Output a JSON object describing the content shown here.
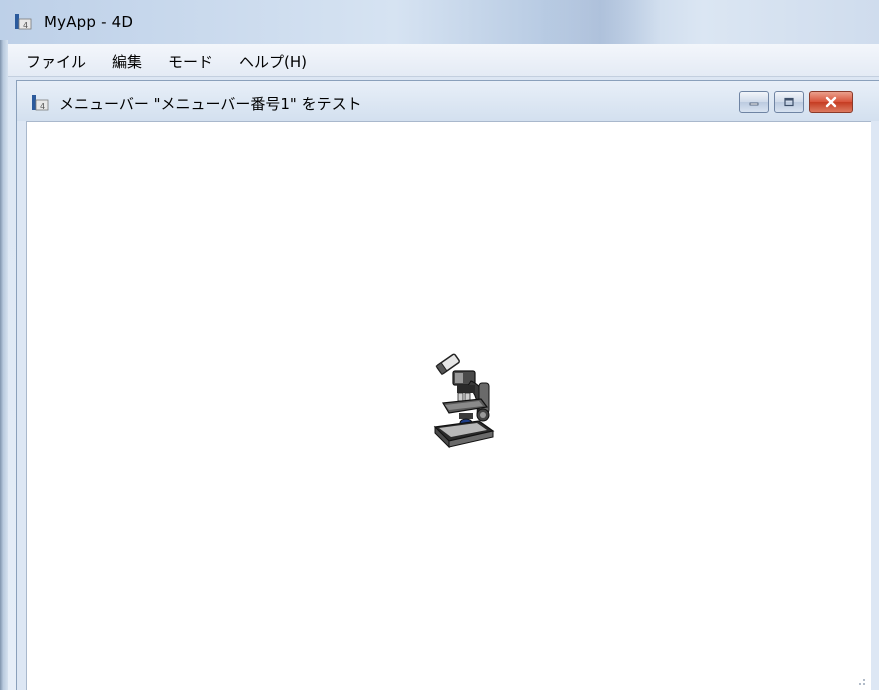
{
  "outer_window": {
    "title": "MyApp - 4D",
    "icon": "4d-app-icon"
  },
  "menubar": {
    "items": [
      {
        "label": "ファイル"
      },
      {
        "label": "編集"
      },
      {
        "label": "モード"
      },
      {
        "label": "ヘルプ(H)"
      }
    ]
  },
  "child_window": {
    "title": "メニューバー \"メニューバー番号1\" をテスト",
    "icon": "4d-app-icon",
    "buttons": {
      "minimize": "minimize-icon",
      "maximize": "maximize-icon",
      "close": "close-icon"
    }
  },
  "content": {
    "center_icon": "microscope-icon"
  },
  "colors": {
    "titlebar": "#c9d9ec",
    "content_bg": "#ffffff",
    "close_button": "#c53c22"
  }
}
